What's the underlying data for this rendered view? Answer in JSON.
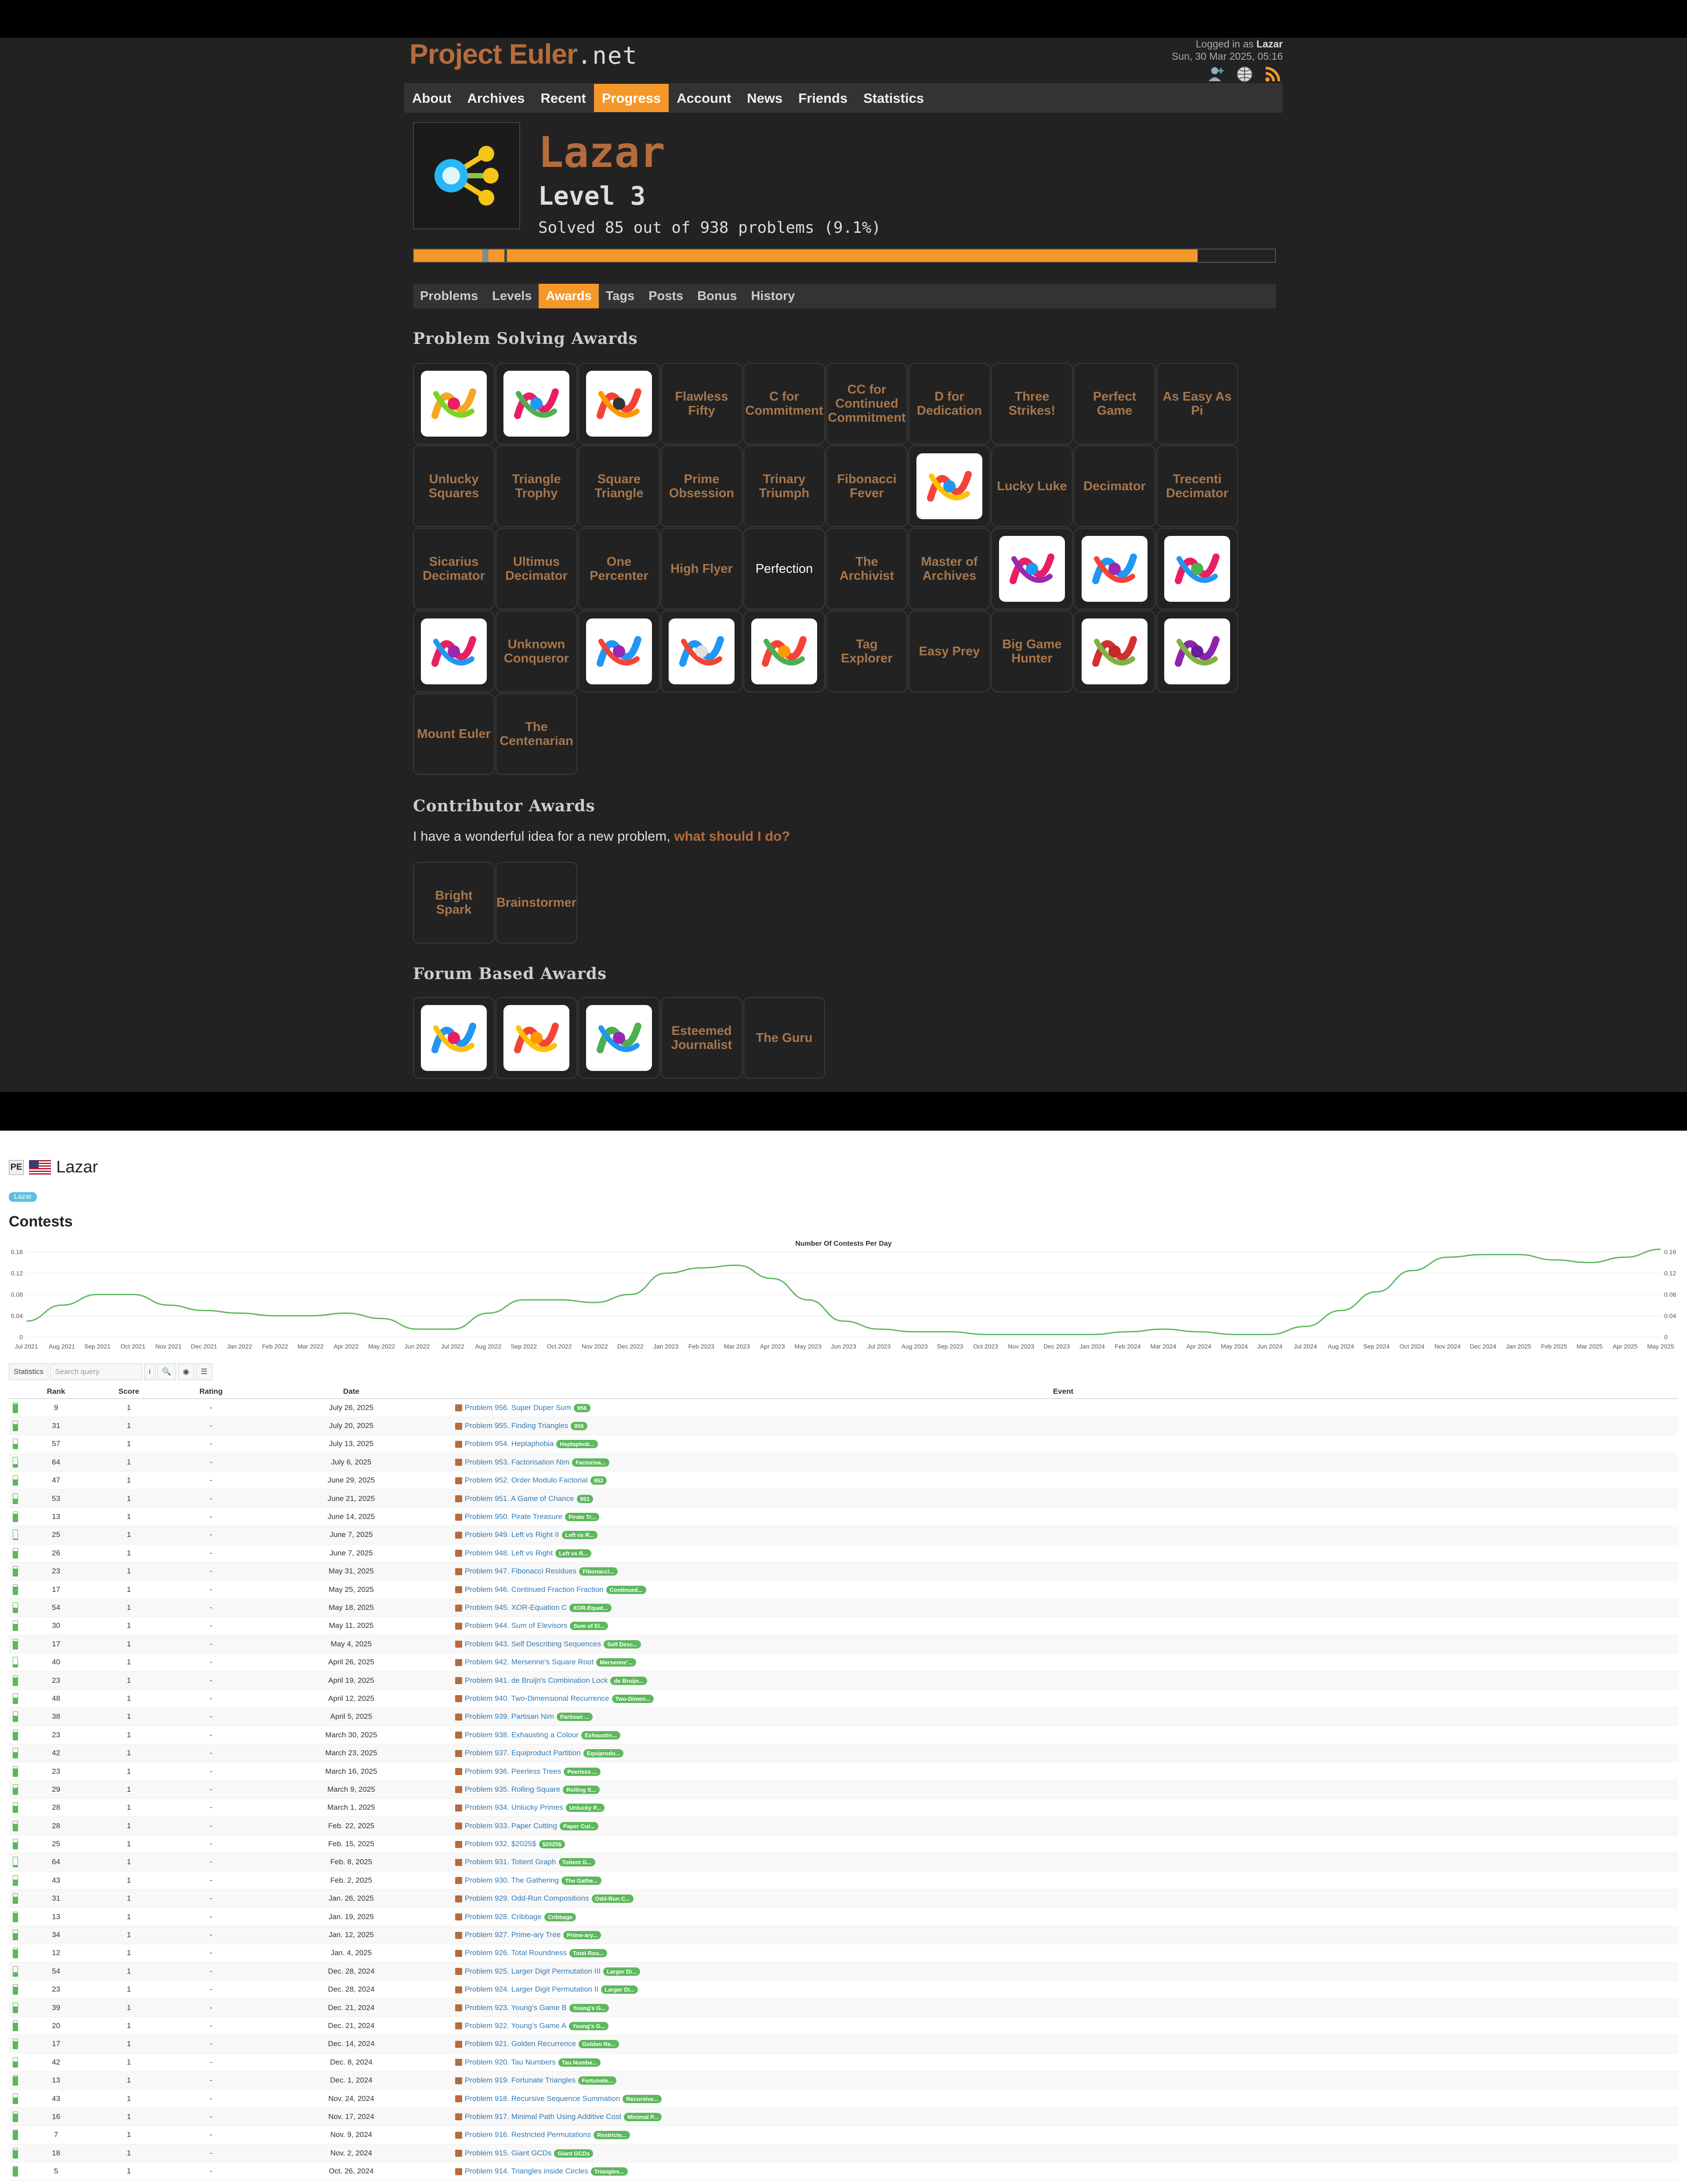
{
  "site": {
    "logo_main": "Project Euler",
    "logo_suffix": ".net",
    "logged_in_prefix": "Logged in as",
    "logged_in_user": "Lazar",
    "datetime": "Sun, 30 Mar 2025, 05:16"
  },
  "nav": [
    "About",
    "Archives",
    "Recent",
    "Progress",
    "Account",
    "News",
    "Friends",
    "Statistics"
  ],
  "nav_active": "Progress",
  "profile": {
    "username": "Lazar",
    "level": "Level 3",
    "solved": "Solved 85 out of 938 problems (9.1%)",
    "progress": 0.091
  },
  "subnav": [
    "Problems",
    "Levels",
    "Awards",
    "Tags",
    "Posts",
    "Bonus",
    "History"
  ],
  "subnav_active": "Awards",
  "sections": {
    "problem_solving": "Problem Solving Awards",
    "contributor": "Contributor Awards",
    "forum": "Forum Based Awards"
  },
  "contributor_text": "I have a wonderful idea for a new problem,",
  "contributor_link": "what should I do?",
  "problem_awards": [
    {
      "label": "",
      "icon": "rings-icon",
      "c": [
        "#f5a623",
        "#7ed321",
        "#e91e63"
      ]
    },
    {
      "label": "",
      "icon": "swirl-icon",
      "c": [
        "#e91e63",
        "#4caf50",
        "#2196f3"
      ]
    },
    {
      "label": "",
      "icon": "g-icon",
      "c": [
        "#f44336",
        "#ff9800",
        "#333333"
      ]
    },
    {
      "label": "Flawless Fifty"
    },
    {
      "label": "C for Commitment"
    },
    {
      "label": "CC for Continued Commitment"
    },
    {
      "label": "D for Dedication"
    },
    {
      "label": "Three Strikes!"
    },
    {
      "label": "Perfect Game"
    },
    {
      "label": "As Easy As Pi"
    },
    {
      "label": "Unlucky Squares"
    },
    {
      "label": "Triangle Trophy"
    },
    {
      "label": "Square Triangle"
    },
    {
      "label": "Prime Obsession"
    },
    {
      "label": "Trinary Triumph"
    },
    {
      "label": "Fibonacci Fever"
    },
    {
      "label": "",
      "icon": "shards-icon",
      "c": [
        "#f44336",
        "#ffc107",
        "#2196f3"
      ]
    },
    {
      "label": "Lucky Luke"
    },
    {
      "label": "Decimator"
    },
    {
      "label": "Trecenti Decimator"
    },
    {
      "label": "Sicarius Decimator"
    },
    {
      "label": "Ultimus Decimator"
    },
    {
      "label": "One Percenter"
    },
    {
      "label": "High Flyer"
    },
    {
      "label": "Perfection",
      "white": true
    },
    {
      "label": "The Archivist"
    },
    {
      "label": "Master of Archives"
    },
    {
      "label": "",
      "icon": "lightning-icon",
      "c": [
        "#e91e63",
        "#9c27b0",
        "#2196f3"
      ]
    },
    {
      "label": "",
      "icon": "plane-icon",
      "c": [
        "#2196f3",
        "#f44336",
        "#9c27b0"
      ]
    },
    {
      "label": "",
      "icon": "flame-icon",
      "c": [
        "#e91e63",
        "#2196f3",
        "#4caf50"
      ]
    },
    {
      "label": "",
      "icon": "wings-icon",
      "c": [
        "#e91e63",
        "#2196f3",
        "#9c27b0"
      ]
    },
    {
      "label": "Unknown Conqueror"
    },
    {
      "label": "",
      "icon": "crown-icon",
      "c": [
        "#2196f3",
        "#f44336",
        "#9c27b0"
      ]
    },
    {
      "label": "",
      "icon": "globe-icon",
      "c": [
        "#2196f3",
        "#f44336",
        "#e0e0e0"
      ]
    },
    {
      "label": "",
      "icon": "spiral-icon",
      "c": [
        "#f44336",
        "#4caf50",
        "#ff9800"
      ]
    },
    {
      "label": "Tag Explorer"
    },
    {
      "label": "Easy Prey"
    },
    {
      "label": "Big Game Hunter"
    },
    {
      "label": "",
      "icon": "berries-red-icon",
      "c": [
        "#d32f2f",
        "#7cb342",
        "#c62828"
      ]
    },
    {
      "label": "",
      "icon": "berries-purple-icon",
      "c": [
        "#8e24aa",
        "#7cb342",
        "#6a1b9a"
      ]
    },
    {
      "label": "Mount Euler"
    },
    {
      "label": "The Centenarian"
    }
  ],
  "contributor_awards": [
    {
      "label": "Bright Spark"
    },
    {
      "label": "Brainstormer"
    }
  ],
  "forum_awards": [
    {
      "label": "",
      "icon": "rainbow-icon",
      "c": [
        "#2196f3",
        "#ffc107",
        "#e91e63"
      ]
    },
    {
      "label": "",
      "icon": "fire-icon",
      "c": [
        "#f44336",
        "#ffc107",
        "#ff9800"
      ]
    },
    {
      "label": "",
      "icon": "mountains-icon",
      "c": [
        "#4caf50",
        "#2196f3",
        "#9c27b0"
      ]
    },
    {
      "label": "Esteemed Journalist"
    },
    {
      "label": "The Guru"
    }
  ],
  "bottom": {
    "pe_icon": "PE",
    "user": "Lazar",
    "tag": "Lazar",
    "heading": "Contests",
    "search_placeholder": "Search query",
    "stats_btn": "Statistics"
  },
  "table_headers": [
    "Rank",
    "Score",
    "Rating",
    "Date",
    "Event"
  ],
  "chart_data": {
    "type": "line",
    "title": "Number Of Contests Per Day",
    "ylim": [
      0,
      0.16
    ],
    "y_ticks": [
      "0",
      "0.04",
      "0.08",
      "0.12",
      "0.16"
    ],
    "categories": [
      "Jul 2021",
      "Aug 2021",
      "Sep 2021",
      "Oct 2021",
      "Nov 2021",
      "Dec 2021",
      "Jan 2022",
      "Feb 2022",
      "Mar 2022",
      "Apr 2022",
      "May 2022",
      "Jun 2022",
      "Jul 2022",
      "Aug 2022",
      "Sep 2022",
      "Oct 2022",
      "Nov 2022",
      "Dec 2022",
      "Jan 2023",
      "Feb 2023",
      "Mar 2023",
      "Apr 2023",
      "May 2023",
      "Jun 2023",
      "Jul 2023",
      "Aug 2023",
      "Sep 2023",
      "Oct 2023",
      "Nov 2023",
      "Dec 2023",
      "Jan 2024",
      "Feb 2024",
      "Mar 2024",
      "Apr 2024",
      "May 2024",
      "Jun 2024",
      "Jul 2024",
      "Aug 2024",
      "Sep 2024",
      "Oct 2024",
      "Nov 2024",
      "Dec 2024",
      "Jan 2025",
      "Feb 2025",
      "Mar 2025",
      "Apr 2025",
      "May 2025"
    ],
    "series": [
      {
        "color": "#5cb85c",
        "values": [
          0.03,
          0.06,
          0.08,
          0.08,
          0.06,
          0.05,
          0.045,
          0.04,
          0.04,
          0.045,
          0.035,
          0.015,
          0.015,
          0.045,
          0.07,
          0.07,
          0.065,
          0.08,
          0.12,
          0.13,
          0.135,
          0.11,
          0.07,
          0.03,
          0.015,
          0.01,
          0.01,
          0.005,
          0.005,
          0.005,
          0.005,
          0.01,
          0.015,
          0.01,
          0.005,
          0.005,
          0.02,
          0.05,
          0.085,
          0.125,
          0.15,
          0.155,
          0.155,
          0.145,
          0.14,
          0.15,
          0.165
        ]
      }
    ]
  },
  "contests": [
    {
      "rank": "9",
      "score": "1",
      "rating": "-",
      "date": "July 26, 2025",
      "event": "Problem 956. Super Duper Sum",
      "badge": "956",
      "bat": 0.9
    },
    {
      "rank": "31",
      "score": "1",
      "rating": "-",
      "date": "July 20, 2025",
      "event": "Problem 955. Finding Triangles",
      "badge": "955",
      "bat": 0.7
    },
    {
      "rank": "57",
      "score": "1",
      "rating": "-",
      "date": "July 13, 2025",
      "event": "Problem 954. Heptaphobia",
      "badge": "Heptaphob...",
      "bat": 0.5
    },
    {
      "rank": "64",
      "score": "1",
      "rating": "-",
      "date": "July 6, 2025",
      "event": "Problem 953. Factorisation Nim",
      "badge": "Factorisa...",
      "bat": 0.3
    },
    {
      "rank": "47",
      "score": "1",
      "rating": "-",
      "date": "June 29, 2025",
      "event": "Problem 952. Order Modulo Factorial",
      "badge": "952",
      "bat": 0.6
    },
    {
      "rank": "53",
      "score": "1",
      "rating": "-",
      "date": "June 21, 2025",
      "event": "Problem 951. A Game of Chance",
      "badge": "951",
      "bat": 0.5
    },
    {
      "rank": "13",
      "score": "1",
      "rating": "-",
      "date": "June 14, 2025",
      "event": "Problem 950. Pirate Treasure",
      "badge": "Pirate Tr...",
      "bat": 0.8
    },
    {
      "rank": "25",
      "score": "1",
      "rating": "-",
      "date": "June 7, 2025",
      "event": "Problem 949. Left vs Right II",
      "badge": "Left vs R...",
      "bat": 0.1
    },
    {
      "rank": "26",
      "score": "1",
      "rating": "-",
      "date": "June 7, 2025",
      "event": "Problem 948. Left vs Right",
      "badge": "Left vs R...",
      "bat": 0.7
    },
    {
      "rank": "23",
      "score": "1",
      "rating": "-",
      "date": "May 31, 2025",
      "event": "Problem 947. Fibonacci Residues",
      "badge": "Fibonacci...",
      "bat": 0.8
    },
    {
      "rank": "17",
      "score": "1",
      "rating": "-",
      "date": "May 25, 2025",
      "event": "Problem 946. Continued Fraction Fraction",
      "badge": "Continued...",
      "bat": 0.8
    },
    {
      "rank": "54",
      "score": "1",
      "rating": "-",
      "date": "May 18, 2025",
      "event": "Problem 945. XOR-Equation C",
      "badge": "XOR-Equat...",
      "bat": 0.5
    },
    {
      "rank": "30",
      "score": "1",
      "rating": "-",
      "date": "May 11, 2025",
      "event": "Problem 944. Sum of Elevisors",
      "badge": "Sum of El...",
      "bat": 0.7
    },
    {
      "rank": "17",
      "score": "1",
      "rating": "-",
      "date": "May 4, 2025",
      "event": "Problem 943. Self Describing Sequences",
      "badge": "Self Desc...",
      "bat": 0.8
    },
    {
      "rank": "40",
      "score": "1",
      "rating": "-",
      "date": "April 26, 2025",
      "event": "Problem 942. Mersenne's Square Root",
      "badge": "Mersenne'...",
      "bat": 0.3
    },
    {
      "rank": "23",
      "score": "1",
      "rating": "-",
      "date": "April 19, 2025",
      "event": "Problem 941. de Bruijn's Combination Lock",
      "badge": "de Bruijn...",
      "bat": 0.8
    },
    {
      "rank": "48",
      "score": "1",
      "rating": "-",
      "date": "April 12, 2025",
      "event": "Problem 940. Two-Dimensional Recurrence",
      "badge": "Two-Dimen...",
      "bat": 0.6
    },
    {
      "rank": "38",
      "score": "1",
      "rating": "-",
      "date": "April 5, 2025",
      "event": "Problem 939. Partisan Nim",
      "badge": "Partisan ...",
      "bat": 0.6
    },
    {
      "rank": "23",
      "score": "1",
      "rating": "-",
      "date": "March 30, 2025",
      "event": "Problem 938. Exhausting a Colour",
      "badge": "Exhaustin...",
      "bat": 0.8
    },
    {
      "rank": "42",
      "score": "1",
      "rating": "-",
      "date": "March 23, 2025",
      "event": "Problem 937. Equiproduct Partition",
      "badge": "Equiprodu...",
      "bat": 0.6
    },
    {
      "rank": "23",
      "score": "1",
      "rating": "-",
      "date": "March 16, 2025",
      "event": "Problem 936. Peerless Trees",
      "badge": "Peerless ...",
      "bat": 0.8
    },
    {
      "rank": "29",
      "score": "1",
      "rating": "-",
      "date": "March 9, 2025",
      "event": "Problem 935. Rolling Square",
      "badge": "Rolling S...",
      "bat": 0.7
    },
    {
      "rank": "28",
      "score": "1",
      "rating": "-",
      "date": "March 1, 2025",
      "event": "Problem 934. Unlucky Primes",
      "badge": "Unlucky P...",
      "bat": 0.7
    },
    {
      "rank": "28",
      "score": "1",
      "rating": "-",
      "date": "Feb. 22, 2025",
      "event": "Problem 933. Paper Cutting",
      "badge": "Paper Cut...",
      "bat": 0.7
    },
    {
      "rank": "25",
      "score": "1",
      "rating": "-",
      "date": "Feb. 15, 2025",
      "event": "Problem 932. $2025$",
      "badge": "$2025$",
      "bat": 0.7
    },
    {
      "rank": "64",
      "score": "1",
      "rating": "-",
      "date": "Feb. 8, 2025",
      "event": "Problem 931. Totient Graph",
      "badge": "Totient G...",
      "bat": 0.2
    },
    {
      "rank": "43",
      "score": "1",
      "rating": "-",
      "date": "Feb. 2, 2025",
      "event": "Problem 930. The Gathering",
      "badge": "The Gathe...",
      "bat": 0.6
    },
    {
      "rank": "31",
      "score": "1",
      "rating": "-",
      "date": "Jan. 26, 2025",
      "event": "Problem 929. Odd-Run Compositions",
      "badge": "Odd-Run C...",
      "bat": 0.7
    },
    {
      "rank": "13",
      "score": "1",
      "rating": "-",
      "date": "Jan. 19, 2025",
      "event": "Problem 928. Cribbage",
      "badge": "Cribbage",
      "bat": 0.9
    },
    {
      "rank": "34",
      "score": "1",
      "rating": "-",
      "date": "Jan. 12, 2025",
      "event": "Problem 927. Prime-ary Tree",
      "badge": "Prime-ary...",
      "bat": 0.7
    },
    {
      "rank": "12",
      "score": "1",
      "rating": "-",
      "date": "Jan. 4, 2025",
      "event": "Problem 926. Total Roundness",
      "badge": "Total Rou...",
      "bat": 0.9
    },
    {
      "rank": "54",
      "score": "1",
      "rating": "-",
      "date": "Dec. 28, 2024",
      "event": "Problem 925. Larger Digit Permutation III",
      "badge": "Larger Di...",
      "bat": 0.4
    },
    {
      "rank": "23",
      "score": "1",
      "rating": "-",
      "date": "Dec. 28, 2024",
      "event": "Problem 924. Larger Digit Permutation II",
      "badge": "Larger Di...",
      "bat": 0.8
    },
    {
      "rank": "39",
      "score": "1",
      "rating": "-",
      "date": "Dec. 21, 2024",
      "event": "Problem 923. Young's Game B",
      "badge": "Young's G...",
      "bat": 0.6
    },
    {
      "rank": "20",
      "score": "1",
      "rating": "-",
      "date": "Dec. 21, 2024",
      "event": "Problem 922. Young's Game A",
      "badge": "Young's G...",
      "bat": 0.8
    },
    {
      "rank": "17",
      "score": "1",
      "rating": "-",
      "date": "Dec. 14, 2024",
      "event": "Problem 921. Golden Recurrence",
      "badge": "Golden Re...",
      "bat": 0.8
    },
    {
      "rank": "42",
      "score": "1",
      "rating": "-",
      "date": "Dec. 8, 2024",
      "event": "Problem 920. Tau Numbers",
      "badge": "Tau Numbe...",
      "bat": 0.6
    },
    {
      "rank": "13",
      "score": "1",
      "rating": "-",
      "date": "Dec. 1, 2024",
      "event": "Problem 919. Fortunate Triangles",
      "badge": "Fortunate...",
      "bat": 0.9
    },
    {
      "rank": "43",
      "score": "1",
      "rating": "-",
      "date": "Nov. 24, 2024",
      "event": "Problem 918. Recursive Sequence Summation",
      "badge": "Recursive...",
      "bat": 0.6
    },
    {
      "rank": "16",
      "score": "1",
      "rating": "-",
      "date": "Nov. 17, 2024",
      "event": "Problem 917. Minimal Path Using Additive Cost",
      "badge": "Minimal P...",
      "bat": 0.8
    },
    {
      "rank": "7",
      "score": "1",
      "rating": "-",
      "date": "Nov. 9, 2024",
      "event": "Problem 916. Restricted Permutations",
      "badge": "Restricte...",
      "bat": 0.95
    },
    {
      "rank": "18",
      "score": "1",
      "rating": "-",
      "date": "Nov. 2, 2024",
      "event": "Problem 915. Giant GCDs",
      "badge": "Giant GCDs",
      "bat": 0.8
    },
    {
      "rank": "5",
      "score": "1",
      "rating": "-",
      "date": "Oct. 26, 2024",
      "event": "Problem 914. Triangles inside Circles",
      "badge": "Triangles...",
      "bat": 0.95
    }
  ]
}
